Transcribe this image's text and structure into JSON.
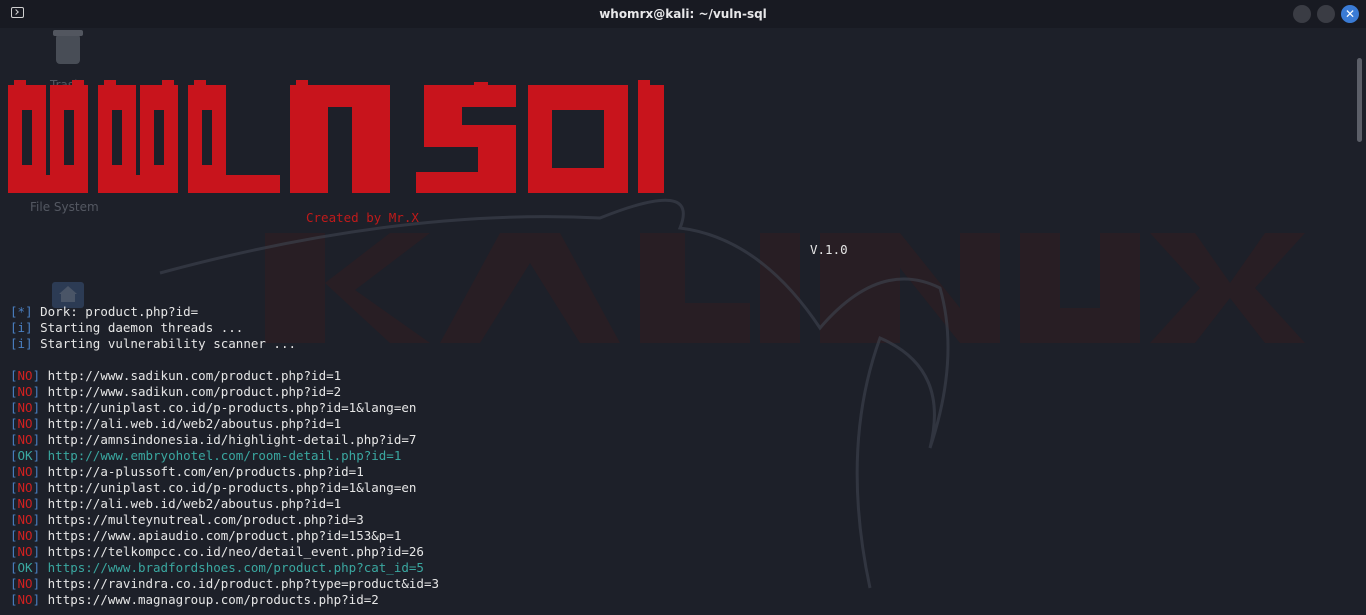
{
  "window": {
    "title": "whomrx@kali: ~/vuln-sql",
    "minimize_label": "",
    "maximize_label": "",
    "close_label": "✕"
  },
  "desktop": {
    "icons": [
      {
        "label": "Trash",
        "icon": "trash-icon"
      },
      {
        "label": "File System",
        "icon": "disk-icon"
      },
      {
        "label": "",
        "icon": "home-folder-icon"
      }
    ]
  },
  "banner": {
    "ascii_title": "VULN SQL",
    "credit": "Created by Mr.X",
    "version": "V.1.0",
    "color": "#c8141c"
  },
  "status_lines": [
    {
      "tag": "*",
      "text": "Dork: product.php?id="
    },
    {
      "tag": "i",
      "text": "Starting daemon threads ..."
    },
    {
      "tag": "i",
      "text": "Starting vulnerability scanner ..."
    }
  ],
  "results": [
    {
      "status": "NO",
      "url": "http://www.sadikun.com/product.php?id=1"
    },
    {
      "status": "NO",
      "url": "http://www.sadikun.com/product.php?id=2"
    },
    {
      "status": "NO",
      "url": "http://uniplast.co.id/p-products.php?id=1&lang=en"
    },
    {
      "status": "NO",
      "url": "http://ali.web.id/web2/aboutus.php?id=1"
    },
    {
      "status": "NO",
      "url": "http://amnsindonesia.id/highlight-detail.php?id=7"
    },
    {
      "status": "OK",
      "url": "http://www.embryohotel.com/room-detail.php?id=1"
    },
    {
      "status": "NO",
      "url": "http://a-plussoft.com/en/products.php?id=1"
    },
    {
      "status": "NO",
      "url": "http://uniplast.co.id/p-products.php?id=1&lang=en"
    },
    {
      "status": "NO",
      "url": "http://ali.web.id/web2/aboutus.php?id=1"
    },
    {
      "status": "NO",
      "url": "https://multeynutreal.com/product.php?id=3"
    },
    {
      "status": "NO",
      "url": "https://www.apiaudio.com/product.php?id=153&p=1"
    },
    {
      "status": "NO",
      "url": "https://telkompcc.co.id/neo/detail_event.php?id=26"
    },
    {
      "status": "OK",
      "url": "https://www.bradfordshoes.com/product.php?cat_id=5"
    },
    {
      "status": "NO",
      "url": "https://ravindra.co.id/product.php?type=product&id=3"
    },
    {
      "status": "NO",
      "url": "https://www.magnagroup.com/products.php?id=2"
    }
  ],
  "colors": {
    "background": "#1d2029",
    "bracket": "#4a7fc1",
    "no": "#d02020",
    "ok": "#3aa7a0",
    "text": "#e6e6e6"
  }
}
